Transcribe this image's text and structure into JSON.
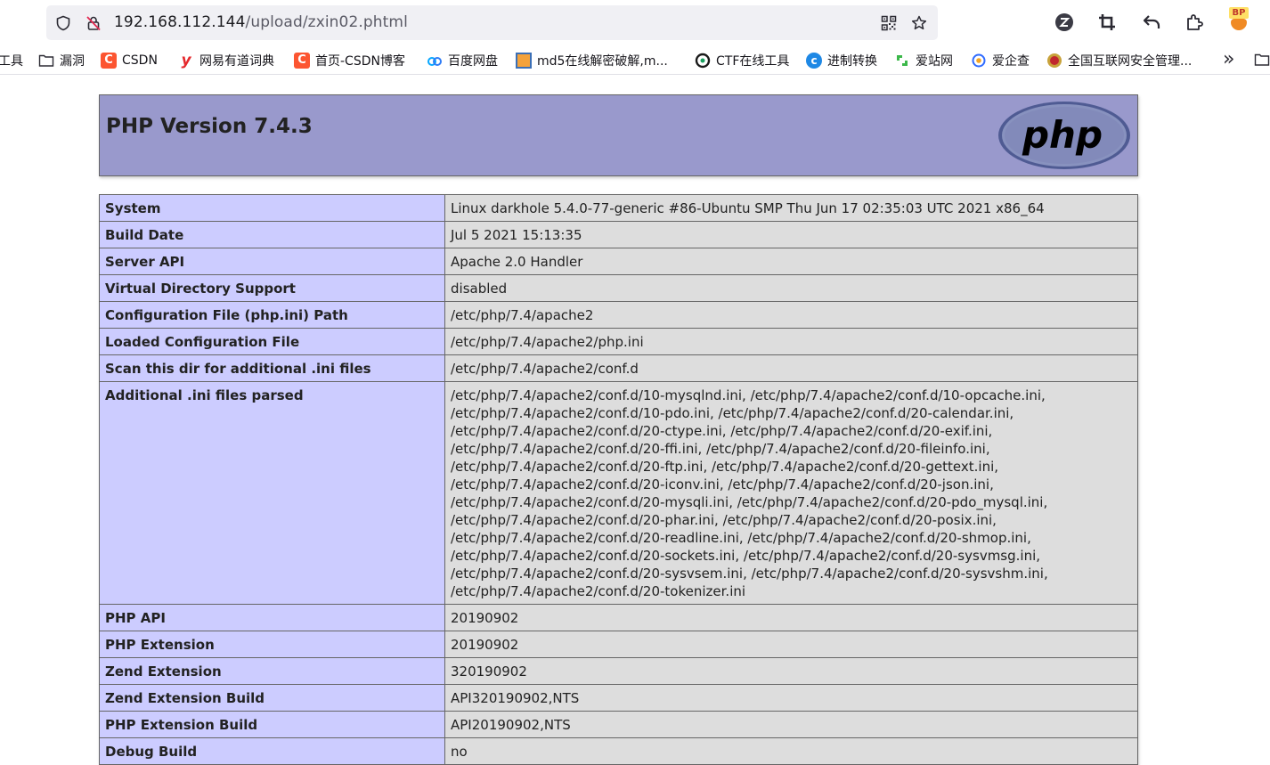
{
  "browser": {
    "url_host": "192.168.112.144",
    "url_path": "/upload/zxin02.phtml",
    "bookmarks": [
      {
        "label": "工具",
        "icon": "none"
      },
      {
        "label": "漏洞",
        "icon": "folder-icon"
      },
      {
        "label": "CSDN",
        "icon": "csdn-icon"
      },
      {
        "label": "网易有道词典",
        "icon": "youdao-icon"
      },
      {
        "label": "首页-CSDN博客",
        "icon": "csdn-icon"
      },
      {
        "label": "百度网盘",
        "icon": "baidu-pan-icon"
      },
      {
        "label": "md5在线解密破解,m...",
        "icon": "md5-icon"
      },
      {
        "label": "CTF在线工具",
        "icon": "ctf-icon"
      },
      {
        "label": "进制转换",
        "icon": "convert-icon"
      },
      {
        "label": "爱站网",
        "icon": "aizhan-icon"
      },
      {
        "label": "爱企查",
        "icon": "aiqicha-icon"
      },
      {
        "label": "全国互联网安全管理...",
        "icon": "police-badge-icon"
      }
    ],
    "more_label": "»",
    "extension_badge": "BP",
    "colors": {
      "urlbar": "#f0f0f4",
      "csdn": "#fc5531",
      "youdao": "#e5282c"
    }
  },
  "phpinfo": {
    "title": "PHP Version 7.4.3",
    "logo_text": "php",
    "colors": {
      "header": "#9999cc",
      "key_cell": "#ccccff",
      "value_cell": "#dddddd"
    },
    "rows": [
      {
        "key": "System",
        "value": "Linux darkhole 5.4.0-77-generic #86-Ubuntu SMP Thu Jun 17 02:35:03 UTC 2021 x86_64"
      },
      {
        "key": "Build Date",
        "value": "Jul 5 2021 15:13:35"
      },
      {
        "key": "Server API",
        "value": "Apache 2.0 Handler"
      },
      {
        "key": "Virtual Directory Support",
        "value": "disabled"
      },
      {
        "key": "Configuration File (php.ini) Path",
        "value": "/etc/php/7.4/apache2"
      },
      {
        "key": "Loaded Configuration File",
        "value": "/etc/php/7.4/apache2/php.ini"
      },
      {
        "key": "Scan this dir for additional .ini files",
        "value": "/etc/php/7.4/apache2/conf.d"
      },
      {
        "key": "Additional .ini files parsed",
        "value": "/etc/php/7.4/apache2/conf.d/10-mysqlnd.ini, /etc/php/7.4/apache2/conf.d/10-opcache.ini, /etc/php/7.4/apache2/conf.d/10-pdo.ini, /etc/php/7.4/apache2/conf.d/20-calendar.ini, /etc/php/7.4/apache2/conf.d/20-ctype.ini, /etc/php/7.4/apache2/conf.d/20-exif.ini, /etc/php/7.4/apache2/conf.d/20-ffi.ini, /etc/php/7.4/apache2/conf.d/20-fileinfo.ini, /etc/php/7.4/apache2/conf.d/20-ftp.ini, /etc/php/7.4/apache2/conf.d/20-gettext.ini, /etc/php/7.4/apache2/conf.d/20-iconv.ini, /etc/php/7.4/apache2/conf.d/20-json.ini, /etc/php/7.4/apache2/conf.d/20-mysqli.ini, /etc/php/7.4/apache2/conf.d/20-pdo_mysql.ini, /etc/php/7.4/apache2/conf.d/20-phar.ini, /etc/php/7.4/apache2/conf.d/20-posix.ini, /etc/php/7.4/apache2/conf.d/20-readline.ini, /etc/php/7.4/apache2/conf.d/20-shmop.ini, /etc/php/7.4/apache2/conf.d/20-sockets.ini, /etc/php/7.4/apache2/conf.d/20-sysvmsg.ini, /etc/php/7.4/apache2/conf.d/20-sysvsem.ini, /etc/php/7.4/apache2/conf.d/20-sysvshm.ini, /etc/php/7.4/apache2/conf.d/20-tokenizer.ini"
      },
      {
        "key": "PHP API",
        "value": "20190902"
      },
      {
        "key": "PHP Extension",
        "value": "20190902"
      },
      {
        "key": "Zend Extension",
        "value": "320190902"
      },
      {
        "key": "Zend Extension Build",
        "value": "API320190902,NTS"
      },
      {
        "key": "PHP Extension Build",
        "value": "API20190902,NTS"
      },
      {
        "key": "Debug Build",
        "value": "no"
      }
    ]
  }
}
